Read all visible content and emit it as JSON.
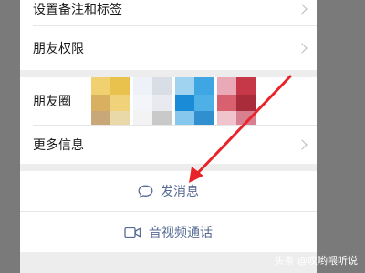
{
  "rows": {
    "remark": {
      "label": "设置备注和标签"
    },
    "permission": {
      "label": "朋友权限"
    },
    "moments": {
      "label": "朋友圈",
      "thumbnails": [
        [
          "#f1d070",
          "#e9c24d",
          "#d8b060",
          "#f0d27a",
          "#c8a878",
          "#ead9a8"
        ],
        [
          "#eef2f8",
          "#d9dee6",
          "#f4f5f8",
          "#e8eaef",
          "#f3f3f3",
          "#c9c9c9"
        ],
        [
          "#9fd3f0",
          "#3ea6e2",
          "#1a8bd6",
          "#4db1e8",
          "#86c7ee",
          "#2f8fcf"
        ],
        [
          "#e9a9b6",
          "#c63848",
          "#d9606f",
          "#a82c3a",
          "#f0c4cc",
          "#d98090"
        ]
      ]
    },
    "more": {
      "label": "更多信息"
    }
  },
  "actions": {
    "message": {
      "label": "发消息",
      "icon": "chat-bubble-icon"
    },
    "call": {
      "label": "音视频通话",
      "icon": "video-camera-icon"
    }
  },
  "annotation": {
    "color": "#e8242a"
  },
  "watermark": {
    "text": "头条 @叹哟喂听说"
  }
}
